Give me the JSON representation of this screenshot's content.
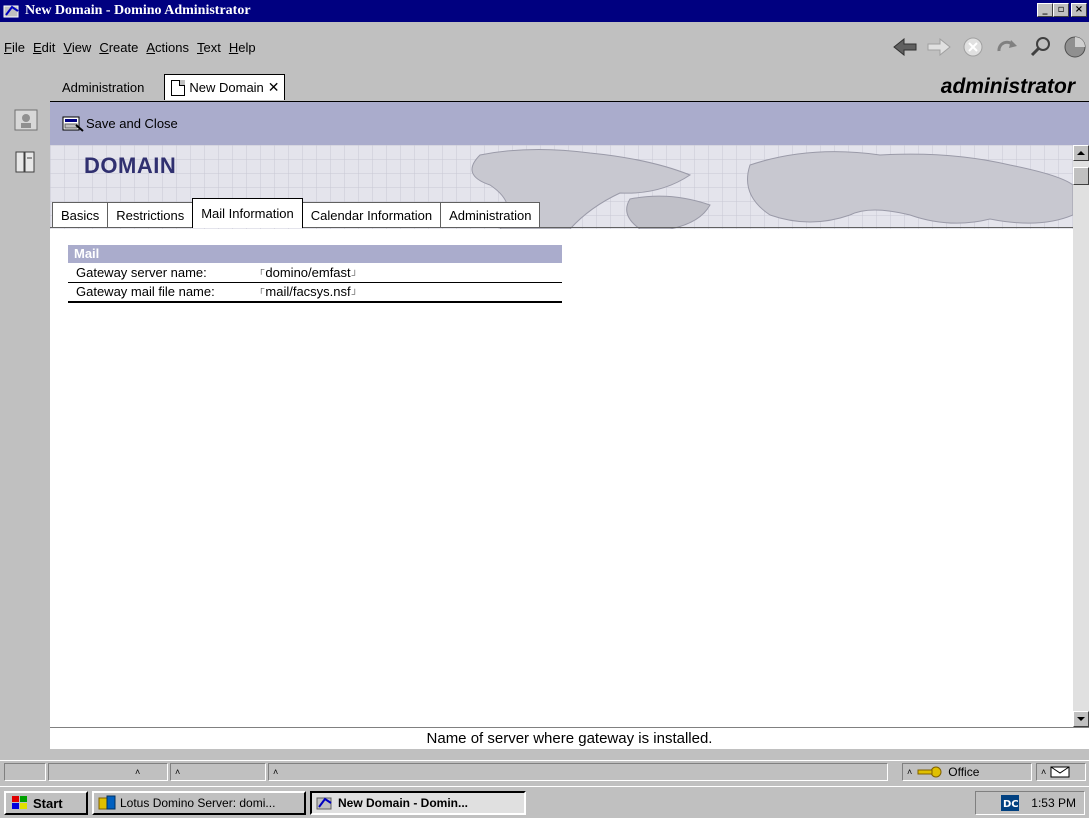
{
  "window": {
    "title": "New Domain - Domino Administrator",
    "controls": {
      "minimize": "_",
      "maximize": "▫",
      "close": "✕"
    }
  },
  "menu": [
    "File",
    "Edit",
    "View",
    "Create",
    "Actions",
    "Text",
    "Help"
  ],
  "window_tabs": [
    {
      "label": "Administration",
      "active": false
    },
    {
      "label": "New Domain",
      "active": true
    }
  ],
  "user_label": "administrator",
  "actions": {
    "save_close": "Save and Close"
  },
  "form": {
    "banner_title": "DOMAIN",
    "tabs": [
      "Basics",
      "Restrictions",
      "Mail Information",
      "Calendar Information",
      "Administration"
    ],
    "active_tab": "Mail Information",
    "section": {
      "title": "Mail",
      "fields": [
        {
          "label": "Gateway server name:",
          "value": "domino/emfast"
        },
        {
          "label": "Gateway mail file name:",
          "value": "mail/facsys.nsf"
        }
      ]
    }
  },
  "hint": "Name of server where gateway is installed.",
  "status": {
    "location": "Office"
  },
  "taskbar": {
    "start": "Start",
    "tasks": [
      {
        "label": "Lotus Domino Server: domi...",
        "active": false
      },
      {
        "label": "New Domain - Domin...",
        "active": true
      }
    ],
    "clock": "1:53 PM"
  },
  "colors": {
    "titlebar": "#000080",
    "actionbar": "#aaaccc",
    "banner_title": "#303070",
    "chrome": "#c0c0c0"
  }
}
